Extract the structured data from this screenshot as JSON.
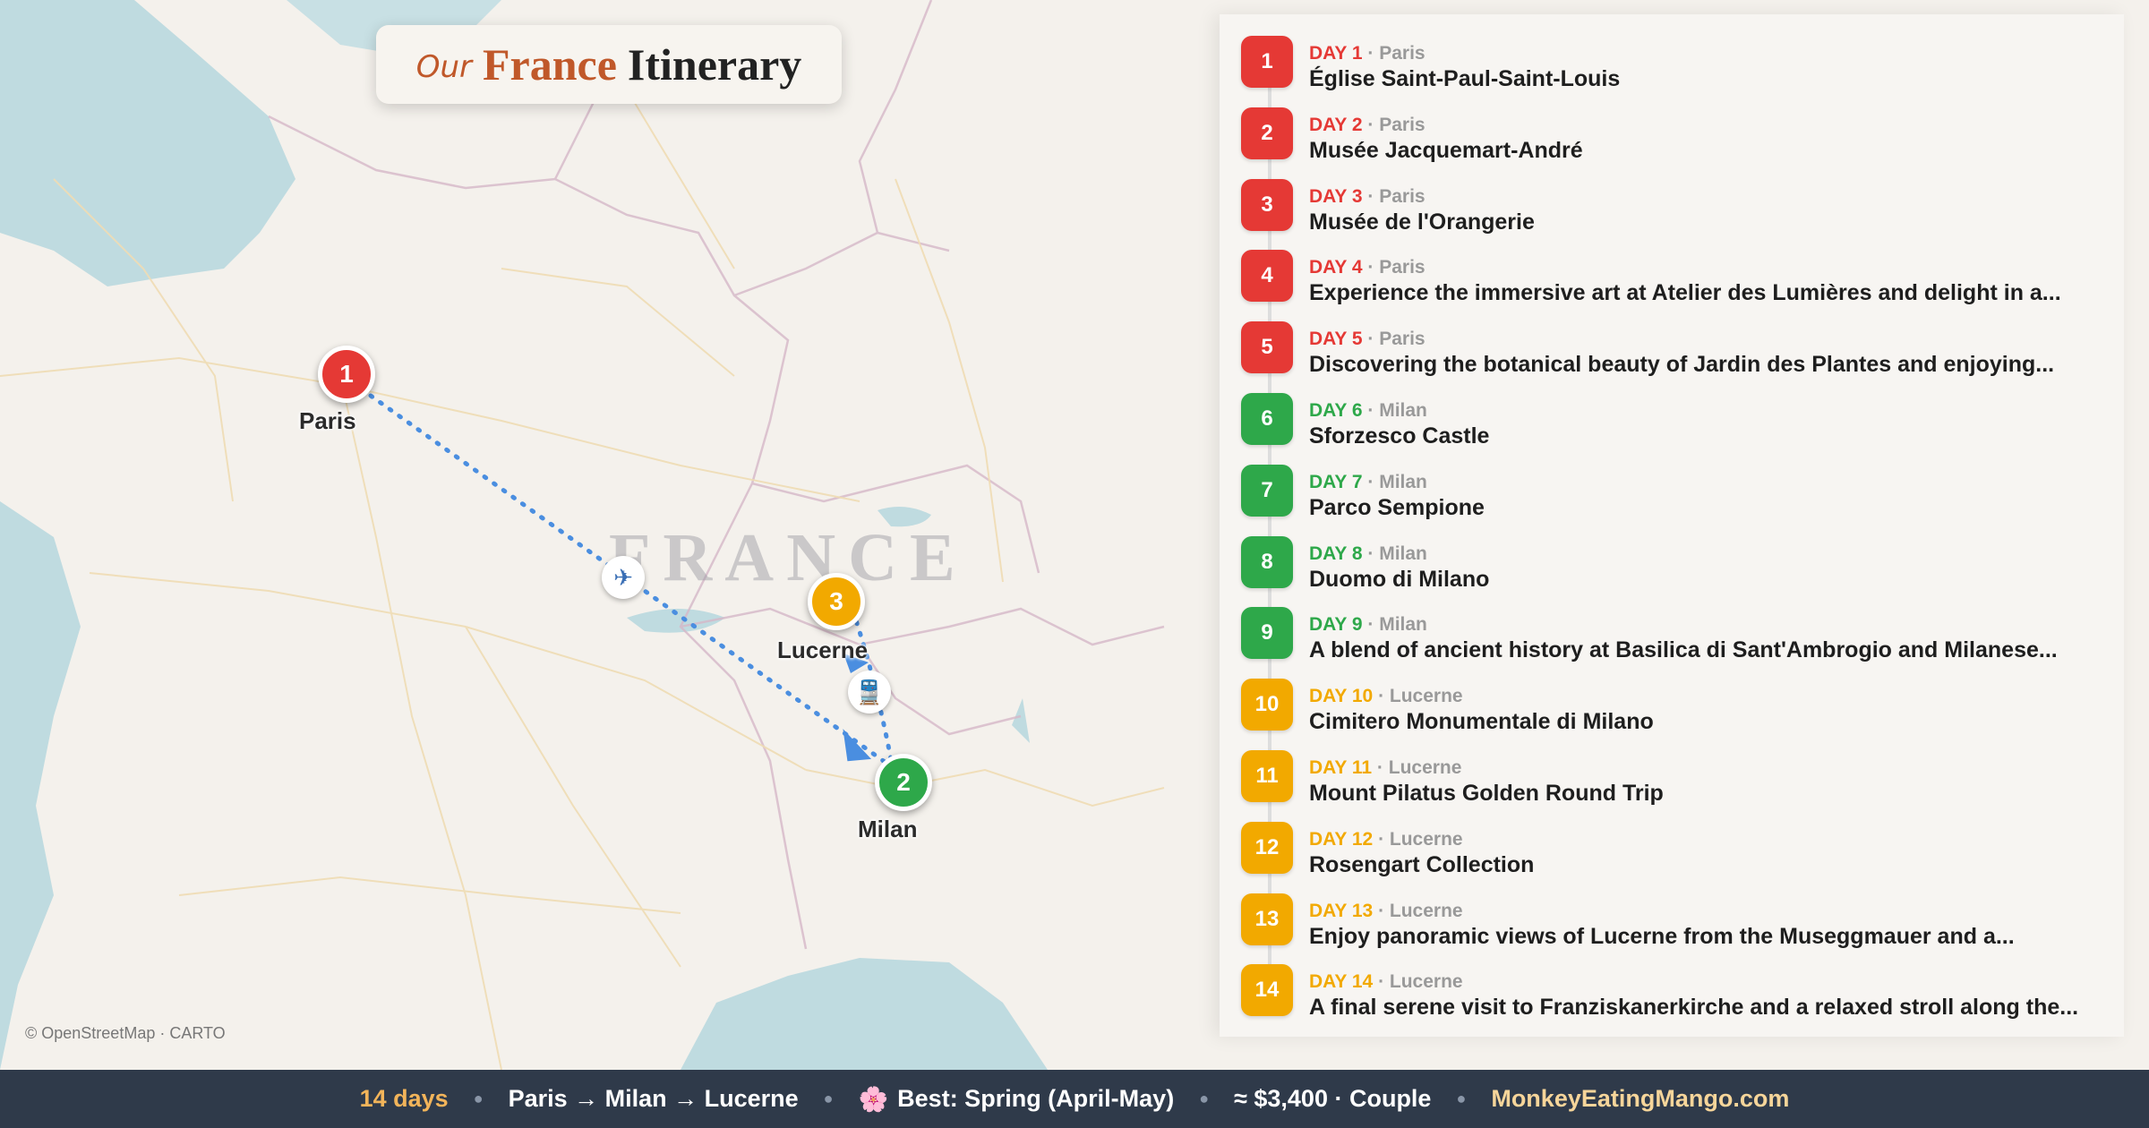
{
  "title": {
    "prefix": "Our",
    "country": "France",
    "suffix": "Itinerary"
  },
  "map": {
    "country_label": "FRANCE",
    "credit": "© OpenStreetMap · CARTO",
    "cities": [
      {
        "name": "Paris",
        "number": "1",
        "color": "#e53935"
      },
      {
        "name": "Milan",
        "number": "2",
        "color": "#2ea84a"
      },
      {
        "name": "Lucerne",
        "number": "3",
        "color": "#f2a900"
      }
    ],
    "legs": [
      {
        "from": "Paris",
        "to": "Milan",
        "mode": "plane-icon",
        "glyph": "✈"
      },
      {
        "from": "Milan",
        "to": "Lucerne",
        "mode": "train-icon",
        "glyph": "🚆"
      }
    ]
  },
  "itinerary": [
    {
      "number": "1",
      "day": "DAY 1",
      "city": "Paris",
      "title": "Église Saint-Paul-Saint-Louis",
      "color": "#e53935"
    },
    {
      "number": "2",
      "day": "DAY 2",
      "city": "Paris",
      "title": "Musée Jacquemart-André",
      "color": "#e53935"
    },
    {
      "number": "3",
      "day": "DAY 3",
      "city": "Paris",
      "title": "Musée de l'Orangerie",
      "color": "#e53935"
    },
    {
      "number": "4",
      "day": "DAY 4",
      "city": "Paris",
      "title": "Experience the immersive art at Atelier des Lumières and delight in a...",
      "color": "#e53935"
    },
    {
      "number": "5",
      "day": "DAY 5",
      "city": "Paris",
      "title": "Discovering the botanical beauty of Jardin des Plantes and enjoying...",
      "color": "#e53935"
    },
    {
      "number": "6",
      "day": "DAY 6",
      "city": "Milan",
      "title": "Sforzesco Castle",
      "color": "#2ea84a"
    },
    {
      "number": "7",
      "day": "DAY 7",
      "city": "Milan",
      "title": "Parco Sempione",
      "color": "#2ea84a"
    },
    {
      "number": "8",
      "day": "DAY 8",
      "city": "Milan",
      "title": "Duomo di Milano",
      "color": "#2ea84a"
    },
    {
      "number": "9",
      "day": "DAY 9",
      "city": "Milan",
      "title": "A blend of ancient history at Basilica di Sant'Ambrogio and Milanese...",
      "color": "#2ea84a"
    },
    {
      "number": "10",
      "day": "DAY 10",
      "city": "Lucerne",
      "title": "Cimitero Monumentale di Milano",
      "color": "#f2a900"
    },
    {
      "number": "11",
      "day": "DAY 11",
      "city": "Lucerne",
      "title": "Mount Pilatus Golden Round Trip",
      "color": "#f2a900"
    },
    {
      "number": "12",
      "day": "DAY 12",
      "city": "Lucerne",
      "title": "Rosengart Collection",
      "color": "#f2a900"
    },
    {
      "number": "13",
      "day": "DAY 13",
      "city": "Lucerne",
      "title": "Enjoy panoramic views of Lucerne from the Museggmauer and a...",
      "color": "#f2a900"
    },
    {
      "number": "14",
      "day": "DAY 14",
      "city": "Lucerne",
      "title": "A final serene visit to Franziskanerkirche and a relaxed stroll along the...",
      "color": "#f2a900"
    }
  ],
  "footer": {
    "days": "14 days",
    "route": "Paris → Milan → Lucerne",
    "season_icon": "🌸",
    "season": "Best: Spring (April-May)",
    "cost": "≈ $3,400 · Couple",
    "site": "MonkeyEatingMango.com"
  }
}
